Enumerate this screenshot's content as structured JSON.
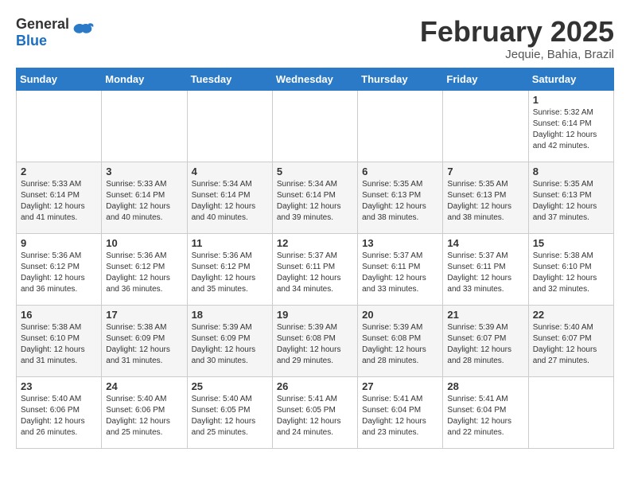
{
  "header": {
    "logo_general": "General",
    "logo_blue": "Blue",
    "month_title": "February 2025",
    "location": "Jequie, Bahia, Brazil"
  },
  "days_of_week": [
    "Sunday",
    "Monday",
    "Tuesday",
    "Wednesday",
    "Thursday",
    "Friday",
    "Saturday"
  ],
  "weeks": [
    [
      {
        "day": "",
        "info": ""
      },
      {
        "day": "",
        "info": ""
      },
      {
        "day": "",
        "info": ""
      },
      {
        "day": "",
        "info": ""
      },
      {
        "day": "",
        "info": ""
      },
      {
        "day": "",
        "info": ""
      },
      {
        "day": "1",
        "info": "Sunrise: 5:32 AM\nSunset: 6:14 PM\nDaylight: 12 hours\nand 42 minutes."
      }
    ],
    [
      {
        "day": "2",
        "info": "Sunrise: 5:33 AM\nSunset: 6:14 PM\nDaylight: 12 hours\nand 41 minutes."
      },
      {
        "day": "3",
        "info": "Sunrise: 5:33 AM\nSunset: 6:14 PM\nDaylight: 12 hours\nand 40 minutes."
      },
      {
        "day": "4",
        "info": "Sunrise: 5:34 AM\nSunset: 6:14 PM\nDaylight: 12 hours\nand 40 minutes."
      },
      {
        "day": "5",
        "info": "Sunrise: 5:34 AM\nSunset: 6:14 PM\nDaylight: 12 hours\nand 39 minutes."
      },
      {
        "day": "6",
        "info": "Sunrise: 5:35 AM\nSunset: 6:13 PM\nDaylight: 12 hours\nand 38 minutes."
      },
      {
        "day": "7",
        "info": "Sunrise: 5:35 AM\nSunset: 6:13 PM\nDaylight: 12 hours\nand 38 minutes."
      },
      {
        "day": "8",
        "info": "Sunrise: 5:35 AM\nSunset: 6:13 PM\nDaylight: 12 hours\nand 37 minutes."
      }
    ],
    [
      {
        "day": "9",
        "info": "Sunrise: 5:36 AM\nSunset: 6:12 PM\nDaylight: 12 hours\nand 36 minutes."
      },
      {
        "day": "10",
        "info": "Sunrise: 5:36 AM\nSunset: 6:12 PM\nDaylight: 12 hours\nand 36 minutes."
      },
      {
        "day": "11",
        "info": "Sunrise: 5:36 AM\nSunset: 6:12 PM\nDaylight: 12 hours\nand 35 minutes."
      },
      {
        "day": "12",
        "info": "Sunrise: 5:37 AM\nSunset: 6:11 PM\nDaylight: 12 hours\nand 34 minutes."
      },
      {
        "day": "13",
        "info": "Sunrise: 5:37 AM\nSunset: 6:11 PM\nDaylight: 12 hours\nand 33 minutes."
      },
      {
        "day": "14",
        "info": "Sunrise: 5:37 AM\nSunset: 6:11 PM\nDaylight: 12 hours\nand 33 minutes."
      },
      {
        "day": "15",
        "info": "Sunrise: 5:38 AM\nSunset: 6:10 PM\nDaylight: 12 hours\nand 32 minutes."
      }
    ],
    [
      {
        "day": "16",
        "info": "Sunrise: 5:38 AM\nSunset: 6:10 PM\nDaylight: 12 hours\nand 31 minutes."
      },
      {
        "day": "17",
        "info": "Sunrise: 5:38 AM\nSunset: 6:09 PM\nDaylight: 12 hours\nand 31 minutes."
      },
      {
        "day": "18",
        "info": "Sunrise: 5:39 AM\nSunset: 6:09 PM\nDaylight: 12 hours\nand 30 minutes."
      },
      {
        "day": "19",
        "info": "Sunrise: 5:39 AM\nSunset: 6:08 PM\nDaylight: 12 hours\nand 29 minutes."
      },
      {
        "day": "20",
        "info": "Sunrise: 5:39 AM\nSunset: 6:08 PM\nDaylight: 12 hours\nand 28 minutes."
      },
      {
        "day": "21",
        "info": "Sunrise: 5:39 AM\nSunset: 6:07 PM\nDaylight: 12 hours\nand 28 minutes."
      },
      {
        "day": "22",
        "info": "Sunrise: 5:40 AM\nSunset: 6:07 PM\nDaylight: 12 hours\nand 27 minutes."
      }
    ],
    [
      {
        "day": "23",
        "info": "Sunrise: 5:40 AM\nSunset: 6:06 PM\nDaylight: 12 hours\nand 26 minutes."
      },
      {
        "day": "24",
        "info": "Sunrise: 5:40 AM\nSunset: 6:06 PM\nDaylight: 12 hours\nand 25 minutes."
      },
      {
        "day": "25",
        "info": "Sunrise: 5:40 AM\nSunset: 6:05 PM\nDaylight: 12 hours\nand 25 minutes."
      },
      {
        "day": "26",
        "info": "Sunrise: 5:41 AM\nSunset: 6:05 PM\nDaylight: 12 hours\nand 24 minutes."
      },
      {
        "day": "27",
        "info": "Sunrise: 5:41 AM\nSunset: 6:04 PM\nDaylight: 12 hours\nand 23 minutes."
      },
      {
        "day": "28",
        "info": "Sunrise: 5:41 AM\nSunset: 6:04 PM\nDaylight: 12 hours\nand 22 minutes."
      },
      {
        "day": "",
        "info": ""
      }
    ]
  ]
}
